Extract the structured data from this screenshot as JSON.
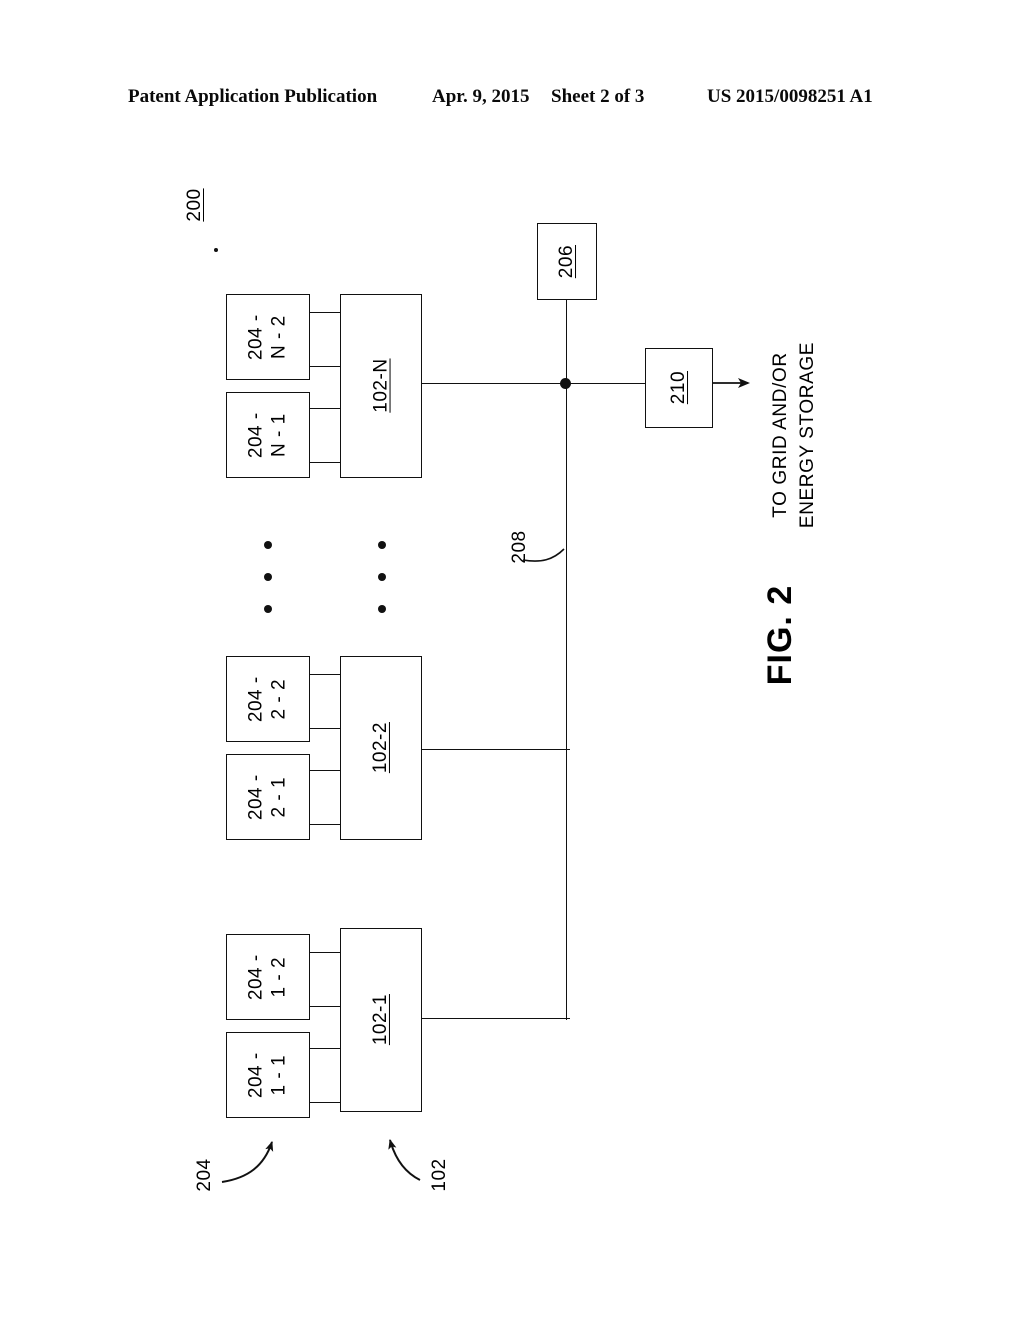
{
  "header": {
    "publication": "Patent Application Publication",
    "date": "Apr. 9, 2015",
    "sheet": "Sheet 2 of 3",
    "number": "US 2015/0098251 A1"
  },
  "figure": {
    "figure_label": "FIG. 2",
    "system_label": "200",
    "bus_label": "208",
    "group_callout_204": "204",
    "group_callout_102": "102",
    "controller_label": "206",
    "output_stage_label": "210",
    "output_text_line1": "TO GRID AND/OR",
    "output_text_line2": "ENERGY STORAGE",
    "groups": [
      {
        "converter": "102-N",
        "sources": [
          "204 -\nN - 2",
          "204 -\nN - 1"
        ]
      },
      {
        "converter": "102-2",
        "sources": [
          "204 -\n2 - 2",
          "204 -\n2 - 1"
        ]
      },
      {
        "converter": "102-1",
        "sources": [
          "204 -\n1 - 2",
          "204 -\n1 - 1"
        ]
      }
    ],
    "ellipsis_marker": "•"
  }
}
